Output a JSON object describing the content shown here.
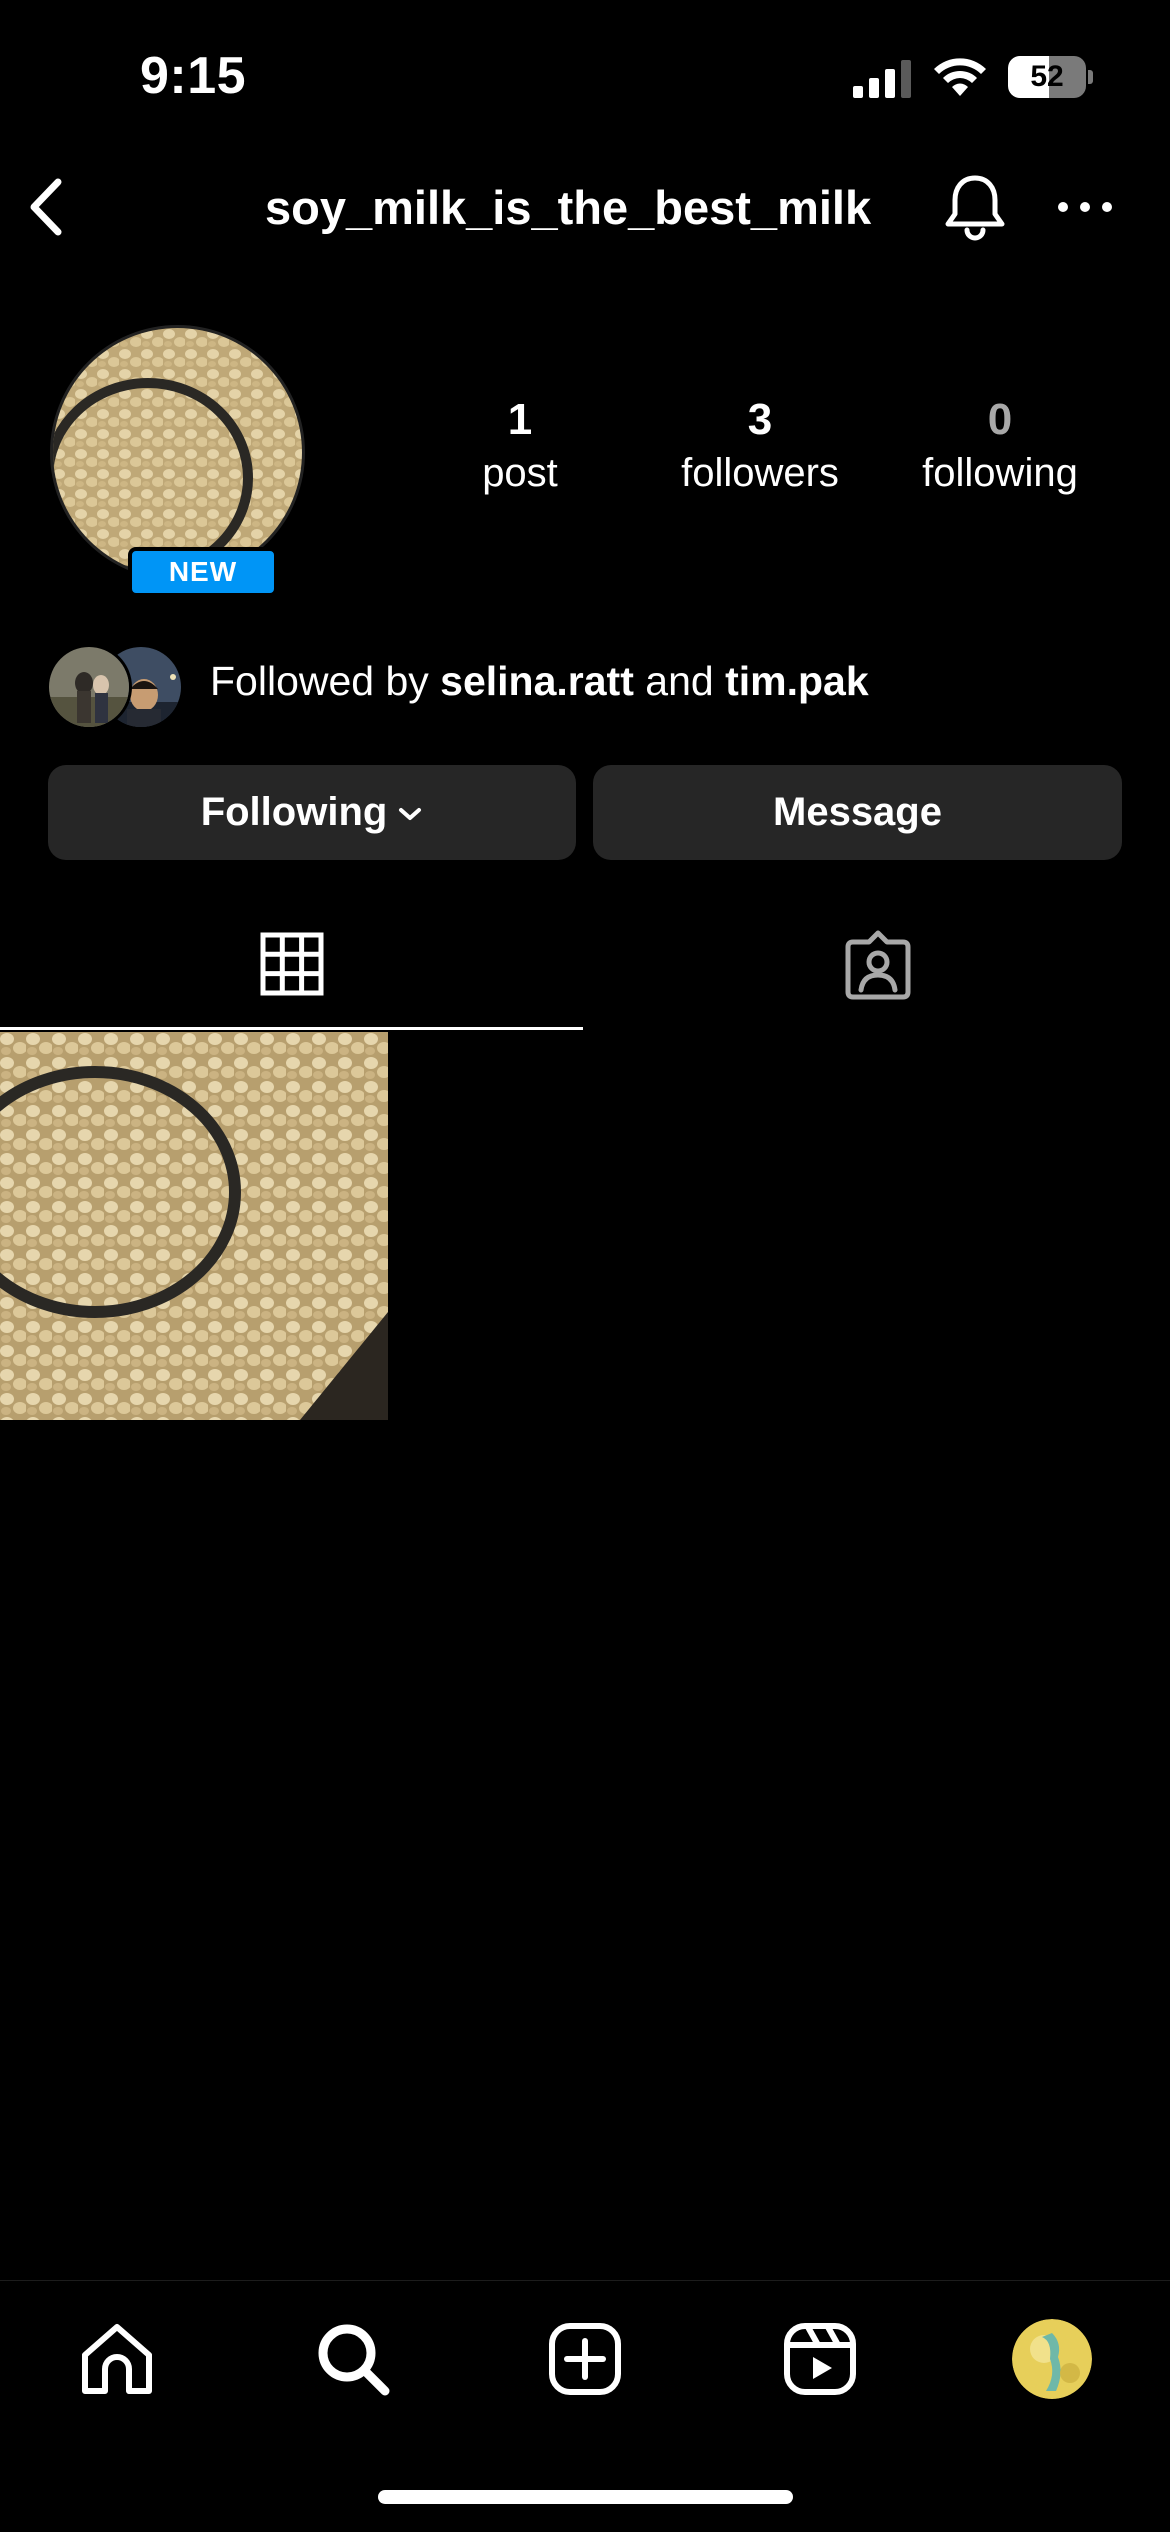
{
  "status_bar": {
    "time": "9:15",
    "battery_level": "52",
    "battery_fraction": 0.52,
    "icons": [
      "signal-icon",
      "wifi-icon",
      "battery-icon"
    ]
  },
  "header": {
    "username": "soy_milk_is_the_best_milk",
    "icons": [
      "back-icon",
      "bell-icon",
      "more-icon"
    ]
  },
  "profile": {
    "badge": "NEW",
    "stats": {
      "posts_count": "1",
      "posts_label": "post",
      "followers_count": "3",
      "followers_label": "followers",
      "following_count": "0",
      "following_label": "following"
    },
    "followed_by": {
      "prefix": "Followed by ",
      "user1": "selina.ratt",
      "joiner": " and ",
      "user2": "tim.pak"
    }
  },
  "actions": {
    "following_label": "Following",
    "message_label": "Message"
  },
  "tabs": [
    {
      "icon": "grid-icon",
      "active": true
    },
    {
      "icon": "tagged-icon",
      "active": false
    }
  ],
  "posts_count_shown": 1,
  "bottom_nav": [
    "home-icon",
    "search-icon",
    "create-icon",
    "reels-icon",
    "profile-avatar"
  ],
  "colors": {
    "background": "#000000",
    "button_bg": "#262626",
    "badge_blue": "#0095f6",
    "muted_text": "#a8a8a8"
  }
}
